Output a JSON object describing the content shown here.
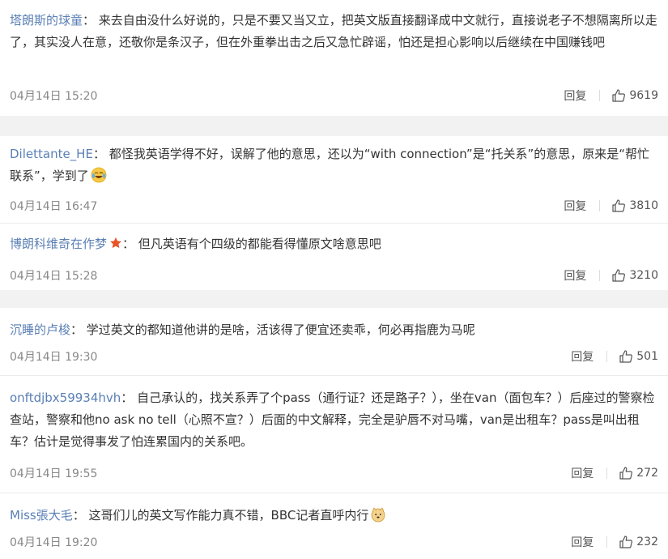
{
  "reply_label": "回复",
  "comments": [
    {
      "user": "塔朗斯的球童",
      "text": "来去自由没什么好说的，只是不要又当又立，把英文版直接翻译成中文就行，直接说老子不想隔离所以走了，其实没人在意，还敬你是条汉子，但在外重拳出击之后又急忙辟谣，怕还是担心影响以后继续在中国赚钱吧",
      "time": "04月14日 15:20",
      "likes": "9619"
    },
    {
      "user": "Dilettante_HE",
      "text": "都怪我英语学得不好，误解了他的意思，还以为“with connection”是“托关系”的意思，原来是“帮忙联系”，学到了",
      "time": "04月14日 16:47",
      "likes": "3810",
      "emoji": "laughing-tears-emoji"
    },
    {
      "user": "博朗科维奇在作梦",
      "text": "但凡英语有个四级的都能看得懂原文啥意思吧",
      "time": "04月14日 15:28",
      "likes": "3210",
      "badge": "star-icon"
    },
    {
      "user": "沉睡的卢梭",
      "text": "学过英文的都知道他讲的是啥，活该得了便宜还卖乖，何必再指鹿为马呢",
      "time": "04月14日 19:30",
      "likes": "501"
    },
    {
      "user": "onftdjbx59934hvh",
      "text": "自己承认的，找关系弄了个pass（通行证？还是路子？），坐在van（面包车？）后座过的警察检查站，警察和他no ask no tell（心照不宣？）后面的中文解释，完全是驴唇不对马嘴，van是出租车？pass是叫出租车？估计是觉得事发了怕连累国内的关系吧。",
      "time": "04月14日 19:55",
      "likes": "272"
    },
    {
      "user": "Miss張大毛",
      "text": "这哥们儿的英文写作能力真不错，BBC记者直呼内行",
      "time": "04月14日 19:20",
      "likes": "232",
      "emoji": "doge-emoji"
    }
  ]
}
